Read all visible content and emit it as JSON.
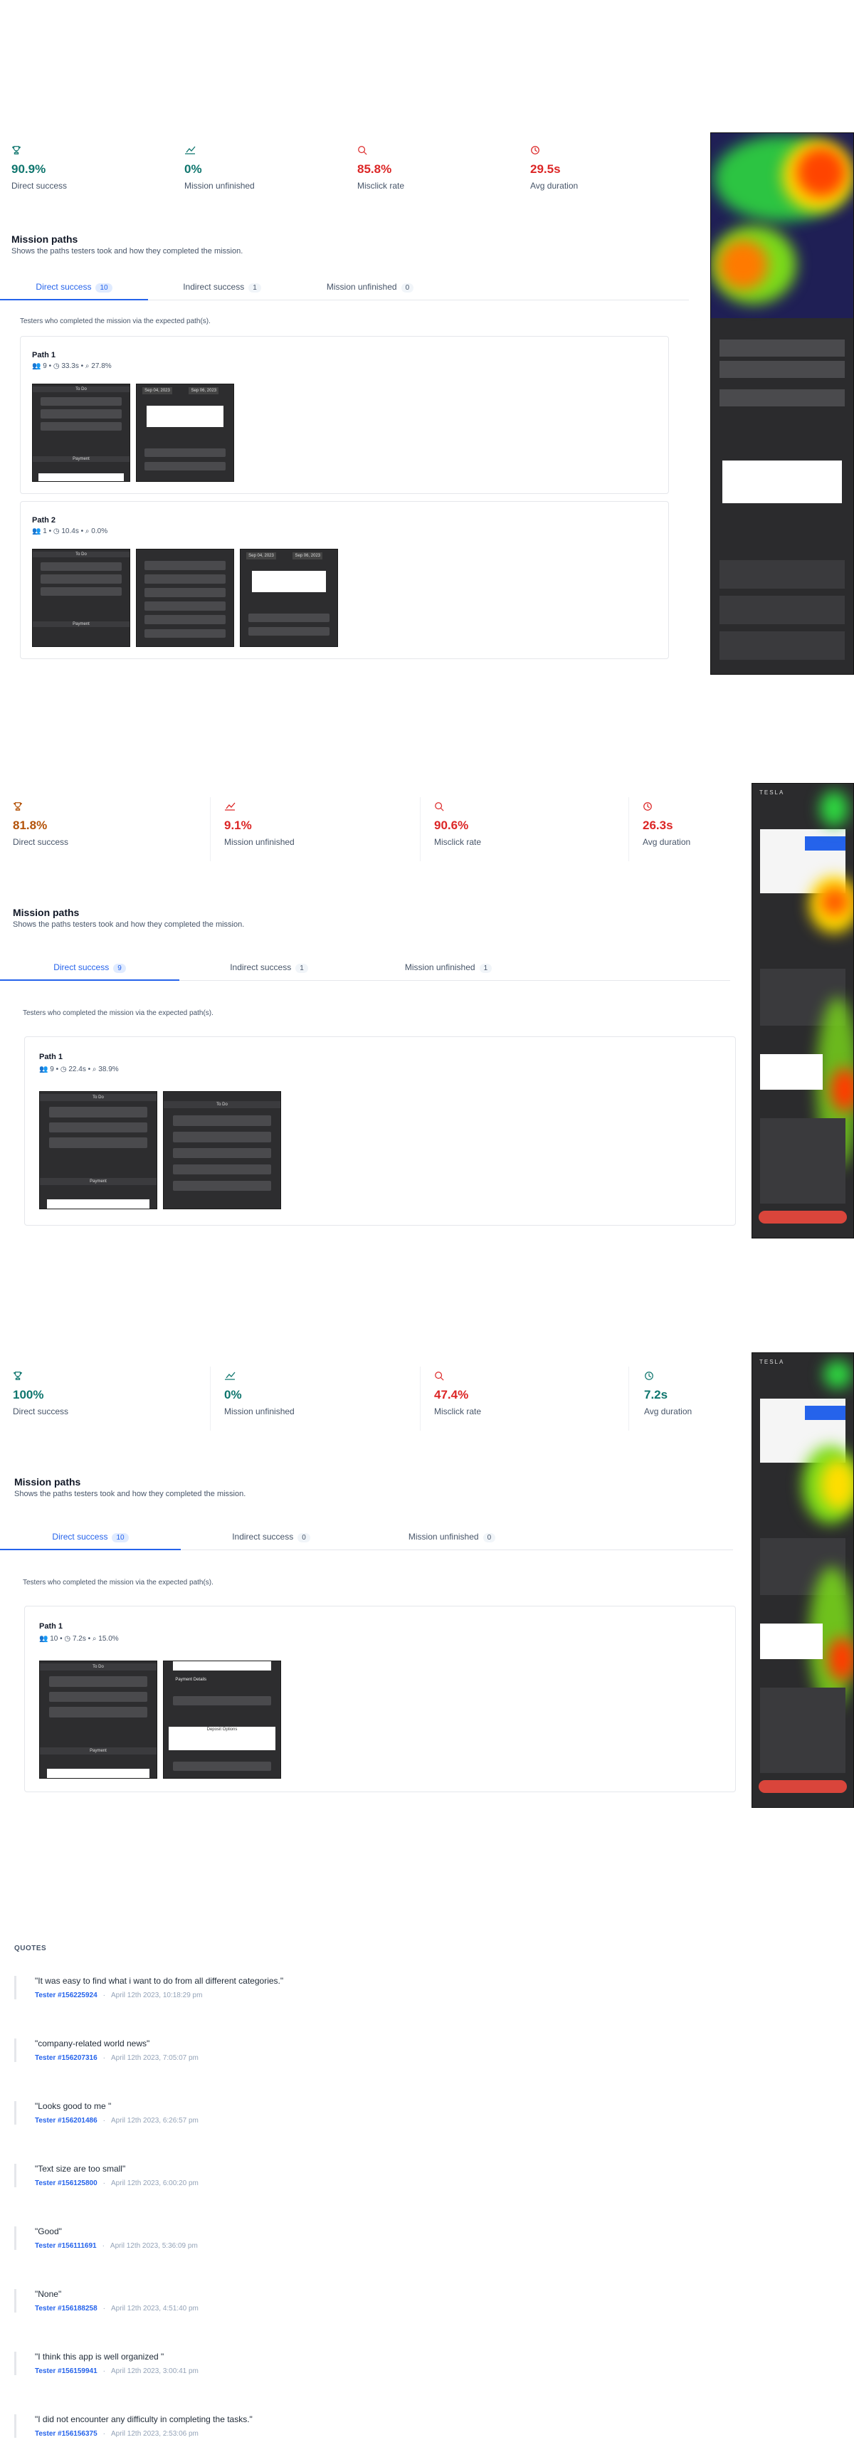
{
  "missions": [
    {
      "stats": [
        {
          "icon": "trophy-icon",
          "value": "90.9%",
          "label": "Direct success",
          "color": "#0f766e"
        },
        {
          "icon": "flag-icon",
          "value": "0%",
          "label": "Mission unfinished",
          "color": "#0f766e"
        },
        {
          "icon": "search-icon",
          "value": "85.8%",
          "label": "Misclick rate",
          "color": "#dc2626"
        },
        {
          "icon": "clock-icon",
          "value": "29.5s",
          "label": "Avg duration",
          "color": "#dc2626"
        }
      ],
      "title": "Mission paths",
      "subtitle": "Shows the paths testers took and how they completed the mission.",
      "tabs": [
        {
          "label": "Direct success",
          "count": "10"
        },
        {
          "label": "Indirect success",
          "count": "1"
        },
        {
          "label": "Mission unfinished",
          "count": "0"
        }
      ],
      "note": "Testers who completed the mission via the expected path(s).",
      "paths": [
        {
          "name": "Path 1",
          "testers": "9",
          "duration": "33.3s",
          "misclick": "27.8%"
        },
        {
          "name": "Path 2",
          "testers": "1",
          "duration": "10.4s",
          "misclick": "0.0%"
        }
      ]
    },
    {
      "stats": [
        {
          "icon": "trophy-icon",
          "value": "81.8%",
          "label": "Direct success",
          "color": "#b45309"
        },
        {
          "icon": "flag-icon",
          "value": "9.1%",
          "label": "Mission unfinished",
          "color": "#dc2626"
        },
        {
          "icon": "search-icon",
          "value": "90.6%",
          "label": "Misclick rate",
          "color": "#dc2626"
        },
        {
          "icon": "clock-icon",
          "value": "26.3s",
          "label": "Avg duration",
          "color": "#dc2626"
        }
      ],
      "title": "Mission paths",
      "subtitle": "Shows the paths testers took and how they completed the mission.",
      "tabs": [
        {
          "label": "Direct success",
          "count": "9"
        },
        {
          "label": "Indirect success",
          "count": "1"
        },
        {
          "label": "Mission unfinished",
          "count": "1"
        }
      ],
      "note": "Testers who completed the mission via the expected path(s).",
      "paths": [
        {
          "name": "Path 1",
          "testers": "9",
          "duration": "22.4s",
          "misclick": "38.9%"
        }
      ]
    },
    {
      "stats": [
        {
          "icon": "trophy-icon",
          "value": "100%",
          "label": "Direct success",
          "color": "#0f766e"
        },
        {
          "icon": "flag-icon",
          "value": "0%",
          "label": "Mission unfinished",
          "color": "#0f766e"
        },
        {
          "icon": "search-icon",
          "value": "47.4%",
          "label": "Misclick rate",
          "color": "#dc2626"
        },
        {
          "icon": "clock-icon",
          "value": "7.2s",
          "label": "Avg duration",
          "color": "#0f766e"
        }
      ],
      "title": "Mission paths",
      "subtitle": "Shows the paths testers took and how they completed the mission.",
      "tabs": [
        {
          "label": "Direct success",
          "count": "10"
        },
        {
          "label": "Indirect success",
          "count": "0"
        },
        {
          "label": "Mission unfinished",
          "count": "0"
        }
      ],
      "note": "Testers who completed the mission via the expected path(s).",
      "paths": [
        {
          "name": "Path 1",
          "testers": "10",
          "duration": "7.2s",
          "misclick": "15.0%"
        }
      ]
    }
  ],
  "shots": {
    "todo": "To Do",
    "payment": "Payment",
    "date1": "Sep 04, 2023",
    "date2": "Sep 06, 2023",
    "payment_details": "Payment Details",
    "deposit_options": "Deposit Options",
    "brand": "TESLA"
  },
  "quotes_heading": "QUOTES",
  "quotes": [
    {
      "text": "\"It was easy to find what i want to do from all different categories.\"",
      "tester": "Tester #156225924",
      "date": "April 12th 2023, 10:18:29 pm"
    },
    {
      "text": "\"company-related world news\"",
      "tester": "Tester #156207316",
      "date": "April 12th 2023, 7:05:07 pm"
    },
    {
      "text": "\"Looks good to me \"",
      "tester": "Tester #156201486",
      "date": "April 12th 2023, 6:26:57 pm"
    },
    {
      "text": "\"Text size are too small\"",
      "tester": "Tester #156125800",
      "date": "April 12th 2023, 6:00:20 pm"
    },
    {
      "text": "\"Good\"",
      "tester": "Tester #156111691",
      "date": "April 12th 2023, 5:36:09 pm"
    },
    {
      "text": "\"None\"",
      "tester": "Tester #156188258",
      "date": "April 12th 2023, 4:51:40 pm"
    },
    {
      "text": "\"I think this app is well organized \"",
      "tester": "Tester #156159941",
      "date": "April 12th 2023, 3:00:41 pm"
    },
    {
      "text": "\"I did not encounter any difficulty in completing the tasks.\"",
      "tester": "Tester #156156375",
      "date": "April 12th 2023, 2:53:06 pm"
    }
  ]
}
